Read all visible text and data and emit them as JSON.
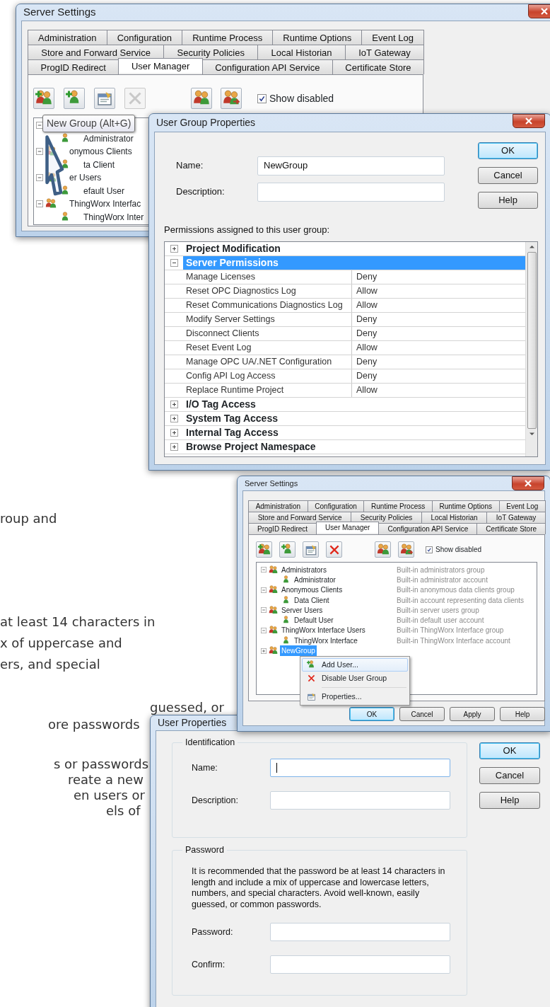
{
  "background_text": [
    "roup and",
    "at least 14 characters in",
    "x of uppercase and",
    "ers, and special",
    "guessed, or",
    "ore passwords",
    "s or passwords",
    "reate a new",
    "en users or",
    "els of"
  ],
  "server_settings_top": {
    "title": "Server Settings",
    "tab_rows": [
      [
        {
          "label": "Administration",
          "selected": false
        },
        {
          "label": "Configuration",
          "selected": false
        },
        {
          "label": "Runtime Process",
          "selected": false
        },
        {
          "label": "Runtime Options",
          "selected": false
        },
        {
          "label": "Event Log",
          "selected": false
        }
      ],
      [
        {
          "label": "Store and Forward Service",
          "selected": false
        },
        {
          "label": "Security Policies",
          "selected": false
        },
        {
          "label": "Local Historian",
          "selected": false
        },
        {
          "label": "IoT Gateway",
          "selected": false
        }
      ],
      [
        {
          "label": "ProgID Redirect",
          "selected": false
        },
        {
          "label": "User Manager",
          "selected": true
        },
        {
          "label": "Configuration API Service",
          "selected": false
        },
        {
          "label": "Certificate Store",
          "selected": false
        }
      ]
    ],
    "toolbar_buttons": [
      {
        "disabled": false
      },
      {
        "disabled": false
      },
      {
        "disabled": false
      },
      {
        "disabled": true
      },
      {
        "disabled": false
      },
      {
        "disabled": false
      }
    ],
    "show_disabled": {
      "label": "Show disabled",
      "checked": true
    },
    "tree": [
      {
        "expanded": true,
        "selected": false,
        "children": [
          {
            "label": "Administrator",
            "selected": false
          }
        ]
      },
      {
        "label": "onymous Clients",
        "expanded": true,
        "selected": false,
        "children": [
          {
            "label": "ta Client",
            "selected": false
          }
        ]
      },
      {
        "label": "er Users",
        "expanded": true,
        "selected": false,
        "children": [
          {
            "label": "efault User",
            "selected": false
          }
        ]
      },
      {
        "label": "ThingWorx Interfac",
        "expanded": true,
        "selected": false,
        "children": [
          {
            "label": "ThingWorx Inter",
            "selected": false
          }
        ]
      }
    ],
    "tooltip": "New Group (Alt+G)"
  },
  "user_group_properties": {
    "title": "User Group Properties",
    "fields": [
      {
        "label": "Name:",
        "value": "NewGroup",
        "focused": false
      },
      {
        "label": "Description:",
        "focused": false
      }
    ],
    "buttons": [
      {
        "label": "OK",
        "default": true
      },
      {
        "label": "Cancel",
        "default": false
      },
      {
        "label": "Help",
        "default": false
      }
    ],
    "permissions_label": "Permissions assigned to this user group:",
    "categories": [
      {
        "label": "Project Modification",
        "expanded": false,
        "selected": false
      },
      {
        "label": "Server Permissions",
        "expanded": true,
        "selected": true,
        "permissions": [
          {
            "name": "Manage Licenses",
            "value": "Deny"
          },
          {
            "name": "Reset OPC Diagnostics Log",
            "value": "Allow"
          },
          {
            "name": "Reset Communications Diagnostics Log",
            "value": "Allow"
          },
          {
            "name": "Modify Server Settings",
            "value": "Deny"
          },
          {
            "name": "Disconnect Clients",
            "value": "Deny"
          },
          {
            "name": "Reset Event Log",
            "value": "Allow"
          },
          {
            "name": "Manage OPC UA/.NET Configuration",
            "value": "Deny"
          },
          {
            "name": "Config API Log Access",
            "value": "Deny"
          },
          {
            "name": "Replace Runtime Project",
            "value": "Allow"
          }
        ]
      },
      {
        "label": "I/O Tag Access",
        "expanded": false,
        "selected": false
      },
      {
        "label": "System Tag Access",
        "expanded": false,
        "selected": false
      },
      {
        "label": "Internal Tag Access",
        "expanded": false,
        "selected": false
      },
      {
        "label": "Browse Project Namespace",
        "expanded": false,
        "selected": false
      }
    ]
  },
  "server_settings_bottom": {
    "title": "Server Settings",
    "tab_rows": [
      [
        {
          "label": "Administration",
          "selected": false
        },
        {
          "label": "Configuration",
          "selected": false
        },
        {
          "label": "Runtime Process",
          "selected": false
        },
        {
          "label": "Runtime Options",
          "selected": false
        },
        {
          "label": "Event Log",
          "selected": false
        }
      ],
      [
        {
          "label": "Store and Forward Service",
          "selected": false
        },
        {
          "label": "Security Policies",
          "selected": false
        },
        {
          "label": "Local Historian",
          "selected": false
        },
        {
          "label": "IoT Gateway",
          "selected": false
        }
      ],
      [
        {
          "label": "ProgID Redirect",
          "selected": false
        },
        {
          "label": "User Manager",
          "selected": true
        },
        {
          "label": "Configuration API Service",
          "selected": false
        },
        {
          "label": "Certificate Store",
          "selected": false
        }
      ]
    ],
    "toolbar_buttons": [
      {
        "disabled": false
      },
      {
        "disabled": false
      },
      {
        "disabled": false
      },
      {
        "disabled": false
      },
      {
        "disabled": false
      },
      {
        "disabled": false
      }
    ],
    "show_disabled": {
      "label": "Show disabled",
      "checked": true
    },
    "tree": [
      {
        "label": "Administrators",
        "description": "Built-in administrators group",
        "expanded": true,
        "selected": false,
        "children": [
          {
            "label": "Administrator",
            "description": "Built-in administrator account",
            "selected": false
          }
        ]
      },
      {
        "label": "Anonymous Clients",
        "description": "Built-in anonymous data clients group",
        "expanded": true,
        "selected": false,
        "children": [
          {
            "label": "Data Client",
            "description": "Built-in account representing data clients",
            "selected": false
          }
        ]
      },
      {
        "label": "Server Users",
        "description": "Built-in server users group",
        "expanded": true,
        "selected": false,
        "children": [
          {
            "label": "Default User",
            "description": "Built-in default user account",
            "selected": false
          }
        ]
      },
      {
        "label": "ThingWorx Interface Users",
        "description": "Built-in ThingWorx Interface group",
        "expanded": true,
        "selected": false,
        "children": [
          {
            "label": "ThingWorx Interface",
            "description": "Built-in ThingWorx Interface account",
            "selected": false
          }
        ]
      },
      {
        "label": "NewGroup",
        "expanded": false,
        "selected": true
      }
    ],
    "context_menu": [
      {
        "kind": "item",
        "label": "Add User...",
        "selected": true
      },
      {
        "kind": "item",
        "label": "Disable User Group",
        "selected": false
      },
      {
        "kind": "separator"
      },
      {
        "kind": "item",
        "label": "Properties...",
        "selected": false
      }
    ],
    "buttons": [
      {
        "label": "OK",
        "default": true
      },
      {
        "label": "Cancel",
        "default": false
      },
      {
        "label": "Apply",
        "default": false
      },
      {
        "label": "Help",
        "default": false
      }
    ]
  },
  "user_properties": {
    "title": "User Properties",
    "identification": {
      "title": "Identification",
      "fields": [
        {
          "label": "Name:",
          "focused": true
        },
        {
          "label": "Description:",
          "focused": false
        }
      ]
    },
    "password": {
      "title": "Password",
      "note": "It is recommended that the password be at least 14 characters in length and include a mix of uppercase and lowercase letters, numbers, and special characters. Avoid well-known, easily guessed, or common passwords.",
      "fields": [
        {
          "label": "Password:",
          "focused": false
        },
        {
          "label": "Confirm:",
          "focused": false
        }
      ]
    },
    "buttons": [
      {
        "label": "OK",
        "default": true
      },
      {
        "label": "Cancel",
        "default": false
      },
      {
        "label": "Help",
        "default": false
      }
    ]
  }
}
